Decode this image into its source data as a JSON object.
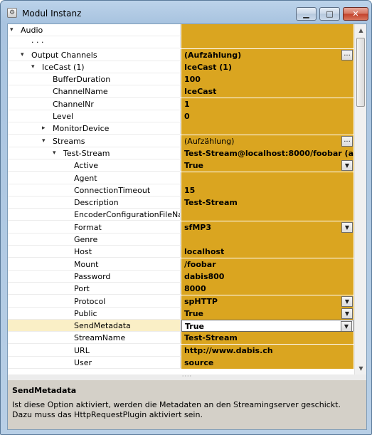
{
  "window": {
    "title": "Modul Instanz"
  },
  "grid": {
    "rows": [
      {
        "name": "Audio",
        "value": "",
        "expander": "▾",
        "bold": false
      },
      {
        "name": "· · ·",
        "value": "",
        "expander": "",
        "bold": false
      },
      {
        "name": "Output Channels",
        "value": "(Aufzählung)",
        "expander": "▾",
        "bold": true,
        "button": "ellipsis"
      },
      {
        "name": "IceCast (1)",
        "value": "IceCast (1)",
        "expander": "▾",
        "bold": true
      },
      {
        "name": "BufferDuration",
        "value": "100",
        "expander": "",
        "bold": true
      },
      {
        "name": "ChannelName",
        "value": "IceCast",
        "expander": "",
        "bold": true
      },
      {
        "name": "ChannelNr",
        "value": "1",
        "expander": "",
        "bold": true
      },
      {
        "name": "Level",
        "value": "0",
        "expander": "",
        "bold": true
      },
      {
        "name": "MonitorDevice",
        "value": "",
        "expander": "▸",
        "bold": false
      },
      {
        "name": "Streams",
        "value": "(Aufzählung)",
        "expander": "▾",
        "bold": false,
        "button": "ellipsis"
      },
      {
        "name": "Test-Stream",
        "value": "Test-Stream@localhost:8000/foobar (a...",
        "expander": "▾",
        "bold": true
      },
      {
        "name": "Active",
        "value": "True",
        "expander": "",
        "bold": true,
        "button": "dropdown"
      },
      {
        "name": "Agent",
        "value": "",
        "expander": "",
        "bold": true
      },
      {
        "name": "ConnectionTimeout",
        "value": "15",
        "expander": "",
        "bold": true
      },
      {
        "name": "Description",
        "value": "Test-Stream",
        "expander": "",
        "bold": true
      },
      {
        "name": "EncoderConfigurationFileName",
        "value": "",
        "expander": "",
        "bold": true
      },
      {
        "name": "Format",
        "value": "sfMP3",
        "expander": "",
        "bold": true,
        "button": "dropdown"
      },
      {
        "name": "Genre",
        "value": "",
        "expander": "",
        "bold": true
      },
      {
        "name": "Host",
        "value": "localhost",
        "expander": "",
        "bold": true
      },
      {
        "name": "Mount",
        "value": "/foobar",
        "expander": "",
        "bold": true
      },
      {
        "name": "Password",
        "value": "dabis800",
        "expander": "",
        "bold": true
      },
      {
        "name": "Port",
        "value": "8000",
        "expander": "",
        "bold": true
      },
      {
        "name": "Protocol",
        "value": "spHTTP",
        "expander": "",
        "bold": true,
        "button": "dropdown"
      },
      {
        "name": "Public",
        "value": "True",
        "expander": "",
        "bold": true,
        "button": "dropdown"
      },
      {
        "name": "SendMetadata",
        "value": "True",
        "expander": "",
        "bold": true,
        "button": "dropdown",
        "selected": true
      },
      {
        "name": "StreamName",
        "value": "Test-Stream",
        "expander": "",
        "bold": true
      },
      {
        "name": "URL",
        "value": "http://www.dabis.ch",
        "expander": "",
        "bold": true
      },
      {
        "name": "User",
        "value": "source",
        "expander": "",
        "bold": true
      }
    ]
  },
  "help": {
    "title": "SendMetadata",
    "text": "Ist diese Option aktiviert, werden die Metadaten an den Streamingserver geschickt. Dazu muss das HttpRequestPlugin aktiviert sein."
  }
}
